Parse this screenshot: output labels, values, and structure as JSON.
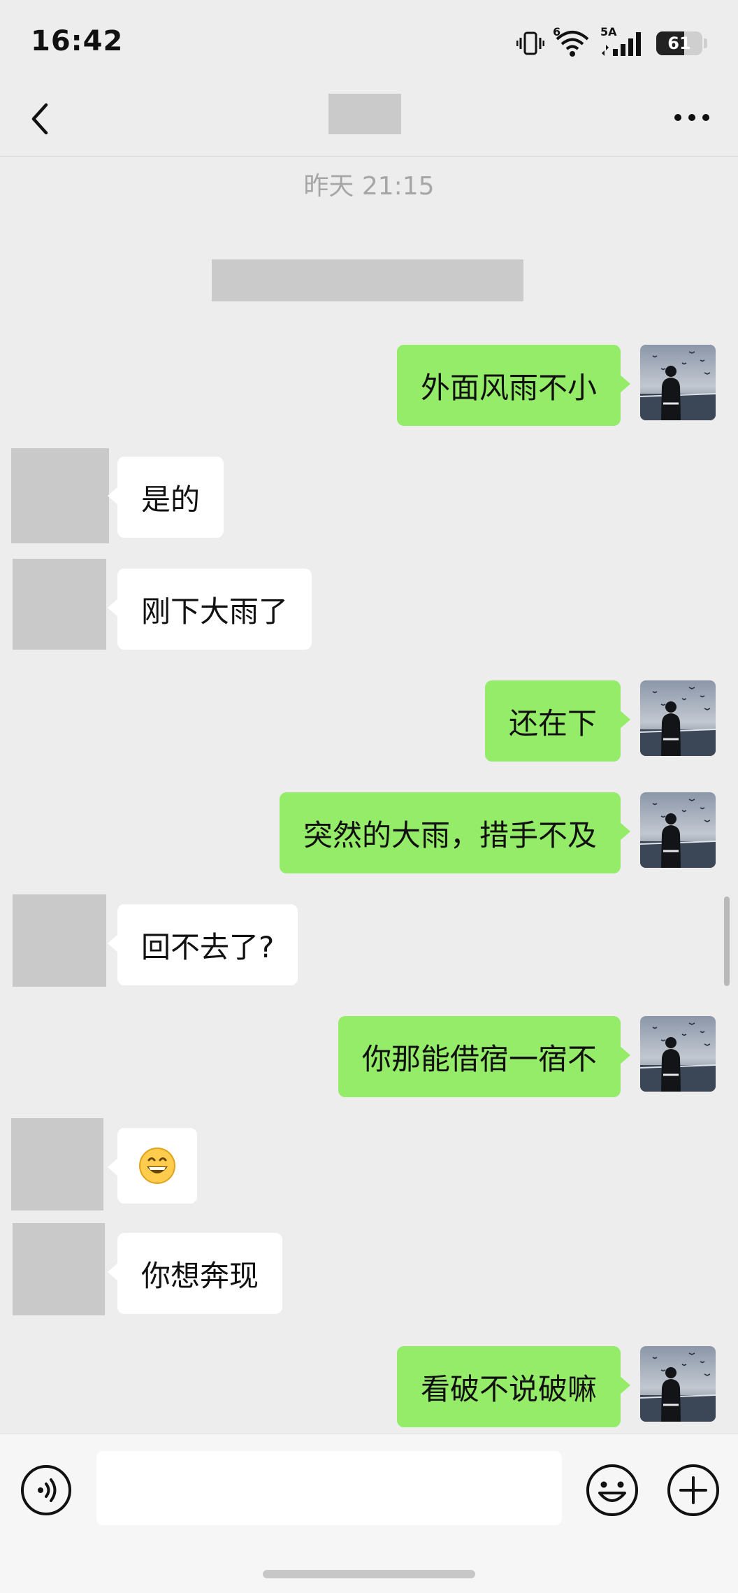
{
  "status_bar": {
    "time": "16:42",
    "network_label": "5A",
    "wifi_label": "6",
    "battery_level": "61",
    "battery_fraction": 0.61
  },
  "header": {
    "title": "",
    "back_icon": "chevron-left-icon",
    "more_icon": "ellipsis-icon"
  },
  "chat": {
    "timestamp": "昨天 21:15",
    "messages": [
      {
        "sender": "me",
        "text": "外面风雨不小"
      },
      {
        "sender": "other",
        "text": "是的"
      },
      {
        "sender": "other",
        "text": "刚下大雨了"
      },
      {
        "sender": "me",
        "text": "还在下"
      },
      {
        "sender": "me",
        "text": "突然的大雨，措手不及"
      },
      {
        "sender": "other",
        "text": "回不去了?"
      },
      {
        "sender": "me",
        "text": "你那能借宿一宿不"
      },
      {
        "sender": "other",
        "text": "😄"
      },
      {
        "sender": "other",
        "text": "你想奔现"
      },
      {
        "sender": "me",
        "text": "看破不说破嘛"
      }
    ]
  },
  "input_bar": {
    "value": "",
    "placeholder": "",
    "voice_icon": "voice-icon",
    "emoji_icon": "emoji-icon",
    "plus_icon": "plus-icon"
  },
  "colors": {
    "background": "#ededed",
    "my_bubble": "#95ec69",
    "other_bubble": "#ffffff",
    "redacted": "#cacaca"
  }
}
